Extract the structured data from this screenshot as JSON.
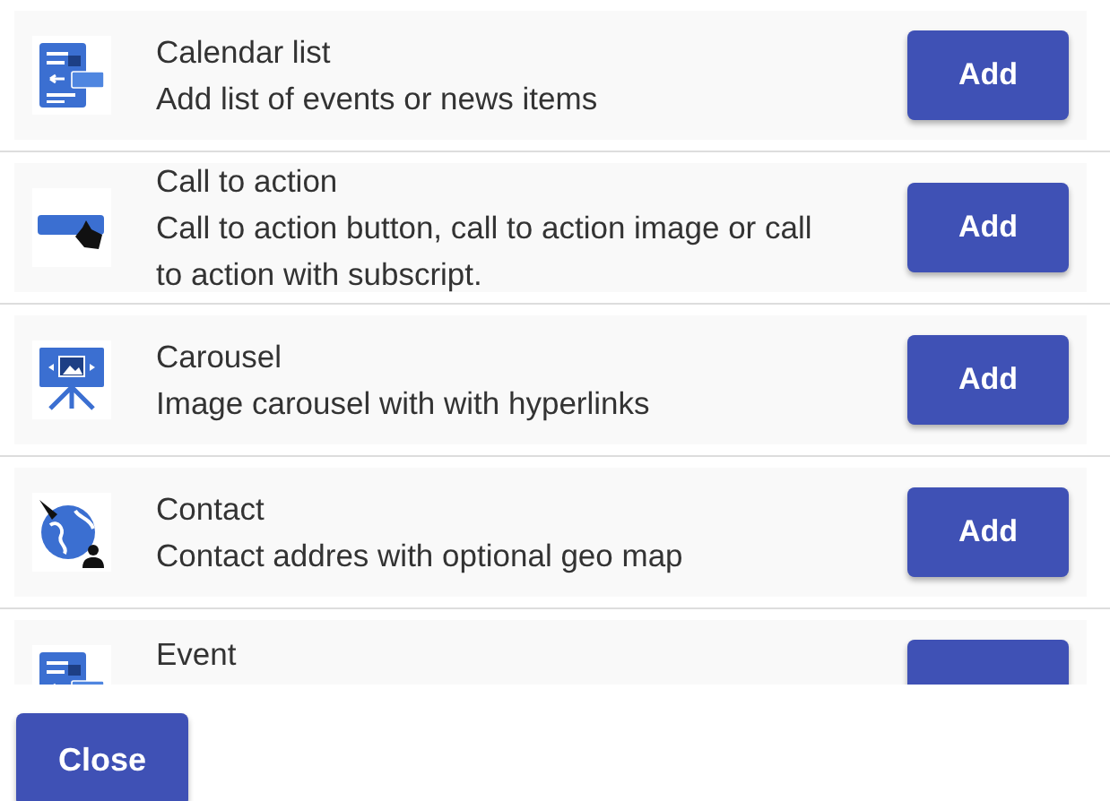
{
  "items": [
    {
      "kind": "document",
      "title": "Calendar list",
      "description": "Add list of events or news items",
      "button": "Add"
    },
    {
      "kind": "action",
      "title": "Call to action",
      "description": "Call to action button, call to action image or call to action with subscript.",
      "button": "Add"
    },
    {
      "kind": "easel",
      "title": "Carousel",
      "description": "Image carousel with with hyperlinks",
      "button": "Add"
    },
    {
      "kind": "globe",
      "title": "Contact",
      "description": "Contact addres with optional geo map",
      "button": "Add"
    },
    {
      "kind": "document",
      "title": "Event"
    }
  ],
  "close_button": "Close"
}
